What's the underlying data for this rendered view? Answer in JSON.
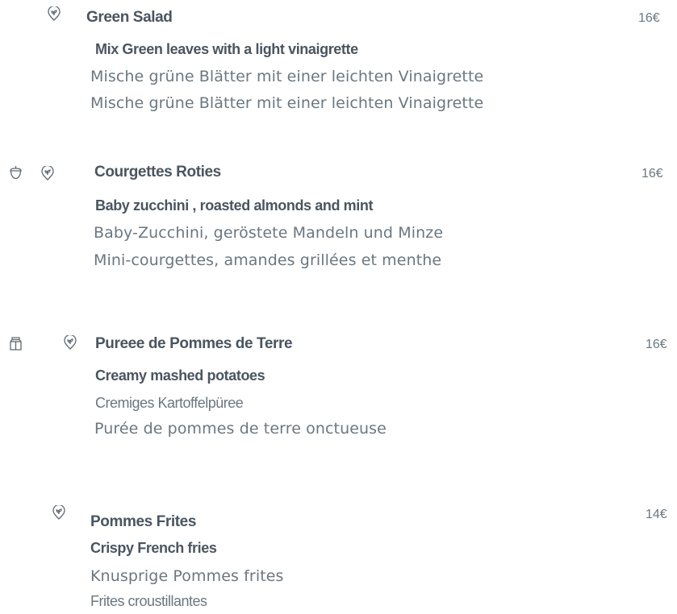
{
  "menu": {
    "items": [
      {
        "name": "Green Salad",
        "price": "16€",
        "english": "Mix Green leaves with a light vinaigrette",
        "german": "Mische grüne Blätter mit einer leichten Vinaigrette",
        "third": "Mische grüne Blätter mit einer leichten Vinaigrette",
        "icons": [
          "vegetarian-icon"
        ]
      },
      {
        "name": "Courgettes Roties",
        "price": "16€",
        "english": "Baby zucchini , roasted almonds and mint",
        "german": "Baby-Zucchini, geröstete Mandeln und Minze",
        "third": "Mini-courgettes, amandes grillées et menthe",
        "icons": [
          "nuts-icon",
          "vegetarian-icon"
        ]
      },
      {
        "name": "Pureee de Pommes de Terre",
        "price": "16€",
        "english": "Creamy mashed potatoes",
        "german": "Cremiges Kartoffelpüree",
        "third": "Purée de pommes de terre onctueuse",
        "icons": [
          "dairy-icon",
          "vegetarian-icon"
        ]
      },
      {
        "name": "Pommes Frites",
        "price": "14€",
        "english": "Crispy French fries",
        "german": "Knusprige Pommes frites",
        "third": "Frites croustillantes",
        "icons": [
          "vegetarian-icon"
        ]
      }
    ]
  },
  "colors": {
    "heading": "#4a5560",
    "body": "#6b7780",
    "icon": "#5f6a73",
    "background": "#ffffff"
  }
}
